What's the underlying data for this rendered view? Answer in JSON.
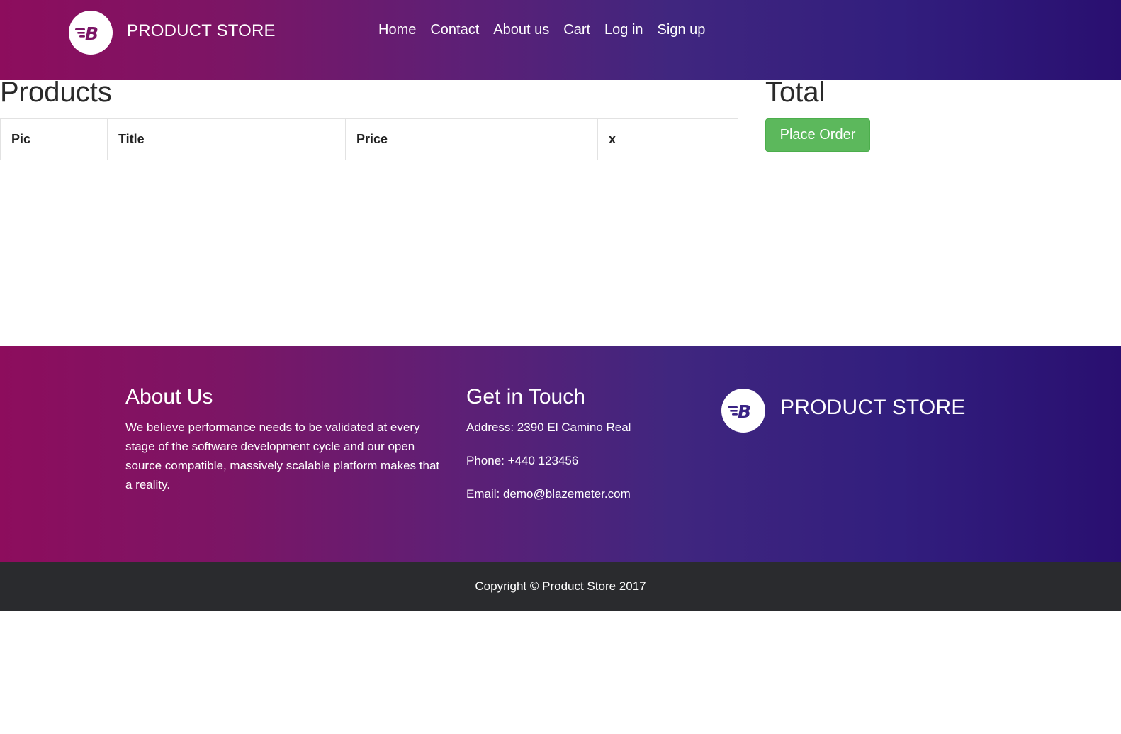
{
  "brand": {
    "name": "PRODUCT STORE",
    "logo_letter": "B"
  },
  "nav": {
    "items": [
      {
        "label": "Home"
      },
      {
        "label": "Contact"
      },
      {
        "label": "About us"
      },
      {
        "label": "Cart"
      },
      {
        "label": "Log in"
      },
      {
        "label": "Sign up"
      }
    ]
  },
  "products": {
    "heading": "Products",
    "columns": [
      "Pic",
      "Title",
      "Price",
      "x"
    ],
    "rows": []
  },
  "total": {
    "heading": "Total",
    "place_order_label": "Place Order"
  },
  "footer": {
    "about": {
      "heading": "About Us",
      "text": "We believe performance needs to be validated at every stage of the software development cycle and our open source compatible, massively scalable platform makes that a reality."
    },
    "contact": {
      "heading": "Get in Touch",
      "address": "Address: 2390 El Camino Real",
      "phone": "Phone: +440 123456",
      "email": "Email: demo@blazemeter.com"
    },
    "brand_name": "PRODUCT STORE",
    "copyright": "Copyright © Product Store 2017"
  },
  "colors": {
    "gradient_start": "#8d0d5d",
    "gradient_end": "#290f70",
    "place_order_button": "#5cb85c",
    "copyright_bar": "#2a2b2e"
  },
  "icons": {
    "logo": "blazemeter-logo-icon"
  }
}
